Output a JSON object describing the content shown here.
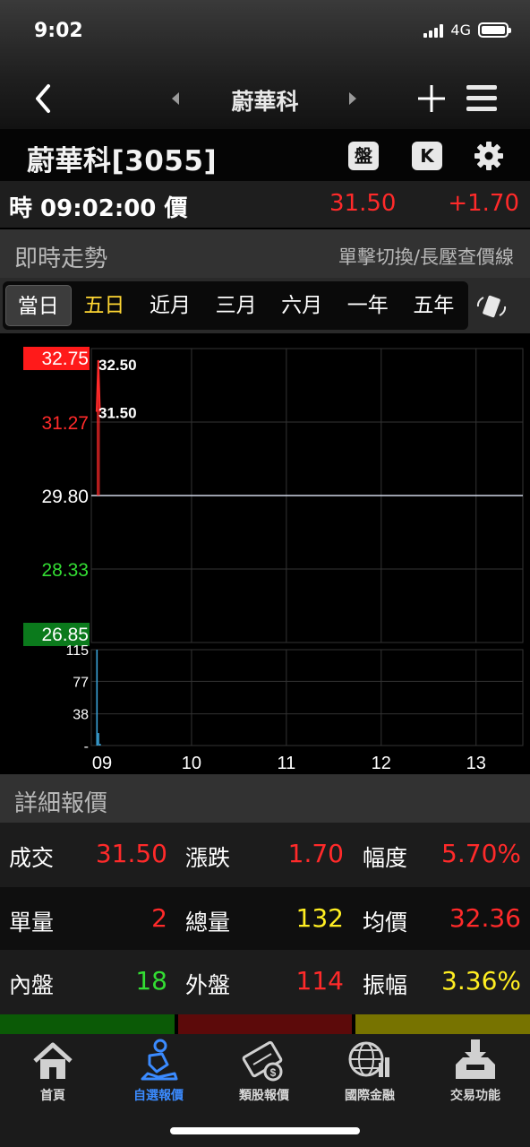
{
  "status_bar": {
    "time": "9:02",
    "network": "4G"
  },
  "nav": {
    "title": "蔚華科"
  },
  "stock": {
    "name": "蔚華科[3055]",
    "btn_pan": "盤",
    "btn_k": "K"
  },
  "quote": {
    "label": "時 09:02:00 價",
    "price": "31.50",
    "change": "+1.70"
  },
  "realtime": {
    "title": "即時走勢",
    "hint": "單擊切換/長壓查價線"
  },
  "tabs": [
    {
      "label": "當日",
      "active": true
    },
    {
      "label": "五日",
      "active": false
    },
    {
      "label": "近月",
      "active": false
    },
    {
      "label": "三月",
      "active": false
    },
    {
      "label": "六月",
      "active": false
    },
    {
      "label": "一年",
      "active": false
    },
    {
      "label": "五年",
      "active": false
    }
  ],
  "chart_data": {
    "type": "line",
    "price_axis": [
      "32.75",
      "31.27",
      "29.80",
      "28.33",
      "26.85"
    ],
    "reference_price": 29.8,
    "annotations": [
      "32.50",
      "31.50"
    ],
    "ylim": [
      26.85,
      32.75
    ],
    "volume_axis": [
      "115",
      "77",
      "38",
      "-"
    ],
    "volume_ylim": [
      0,
      115
    ],
    "x_ticks": [
      "09",
      "10",
      "11",
      "12",
      "13"
    ],
    "price_series": [
      {
        "t": "09:00",
        "price": 31.5
      },
      {
        "t": "09:01",
        "price": 32.5
      },
      {
        "t": "09:02",
        "price": 31.5
      }
    ],
    "volume_series": [
      {
        "t": "09:00",
        "volume": 115
      },
      {
        "t": "09:01",
        "volume": 15
      },
      {
        "t": "09:02",
        "volume": 2
      }
    ],
    "colors": {
      "up": "#ff2a2a",
      "down": "#33dd33",
      "reference": "#cfd6e6",
      "volume": "#3aa3d8",
      "grid": "#333333"
    }
  },
  "detail": {
    "title": "詳細報價",
    "rows": [
      [
        {
          "label": "成交",
          "value": "31.50",
          "color": "red"
        },
        {
          "label": "漲跌",
          "value": "1.70",
          "color": "red"
        },
        {
          "label": "幅度",
          "value": "5.70%",
          "color": "red"
        }
      ],
      [
        {
          "label": "單量",
          "value": "2",
          "color": "red"
        },
        {
          "label": "總量",
          "value": "132",
          "color": "yellow"
        },
        {
          "label": "均價",
          "value": "32.36",
          "color": "red"
        }
      ],
      [
        {
          "label": "內盤",
          "value": "18",
          "color": "green"
        },
        {
          "label": "外盤",
          "value": "114",
          "color": "red"
        },
        {
          "label": "振幅",
          "value": "3.36%",
          "color": "yellow"
        }
      ]
    ]
  },
  "bottom_tabs": [
    {
      "label": "首頁",
      "icon": "home-icon",
      "active": false
    },
    {
      "label": "自選報價",
      "icon": "watchlist-person-icon",
      "active": true
    },
    {
      "label": "類股報價",
      "icon": "film-reel-icon",
      "active": false
    },
    {
      "label": "國際金融",
      "icon": "globe-icon",
      "active": false
    },
    {
      "label": "交易功能",
      "icon": "download-tray-icon",
      "active": false
    }
  ],
  "colors": {
    "accent": "#3b8bff",
    "up": "#ff2a2a",
    "down": "#33dd33",
    "yellow": "#ffee22"
  }
}
